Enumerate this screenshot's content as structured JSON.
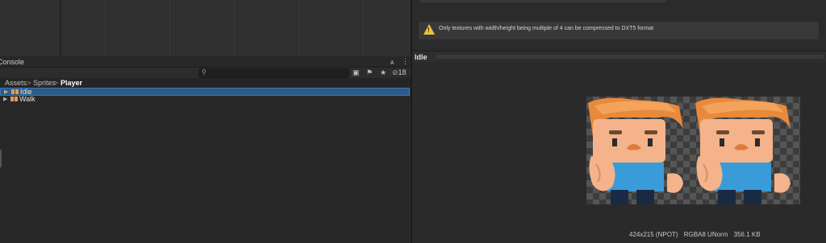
{
  "console": {
    "tab_title": "Console",
    "lock_glyph": "🔒",
    "menu_glyph": "⋮",
    "search_placeholder": "",
    "hidden_count": "18"
  },
  "breadcrumb": {
    "items": [
      "Assets",
      "Sprites",
      "Player"
    ],
    "separator": ">"
  },
  "assets": [
    {
      "label": "Idle",
      "selected": true
    },
    {
      "label": "Walk",
      "selected": false
    }
  ],
  "inspector": {
    "warning_text": "Only textures with width/height being multiple of 4 can be compressed to DXT5 format"
  },
  "preview": {
    "title": "Idle",
    "dimensions": "424x215 (NPOT)",
    "format": "RGBA8 UNorm",
    "size": "356.1 KB"
  },
  "colors": {
    "selection": "#2c5d87",
    "warning": "#e8c43a",
    "hair": "#e8893c",
    "skin": "#f4b38a",
    "shirt": "#3a9bd9"
  }
}
